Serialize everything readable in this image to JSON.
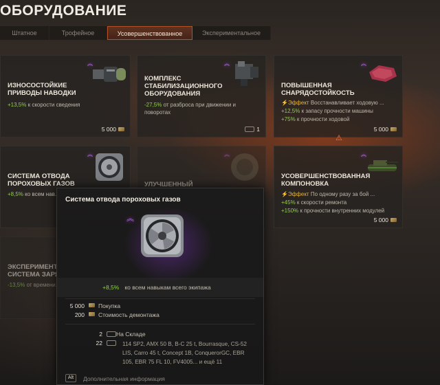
{
  "page": {
    "title": "ОБОРУДОВАНИЕ"
  },
  "tabs": [
    {
      "label": "Штатное"
    },
    {
      "label": "Трофейное"
    },
    {
      "label": "Усовершенствованное",
      "selected": true
    },
    {
      "label": "Экспериментальное"
    }
  ],
  "cards": [
    {
      "title": "ИЗНОСОСТОЙКИЕ ПРИВОДЫ НАВОДКИ",
      "bonus_value": "+13,5%",
      "bonus_text": "к скорости сведения",
      "price": "5 000"
    },
    {
      "title": "КОМПЛЕКС СТАБИЛИЗАЦИОННОГО ОБОРУДОВАНИЯ",
      "bonus_value": "-27,5%",
      "bonus_text": "от разброса при движении и поворотах",
      "count": "1"
    },
    {
      "title": "ПОВЫШЕННАЯ СНАРЯДОСТОЙКОСТЬ",
      "effect_label": "Эффект",
      "effect_text": "Восстанавливает ходовую ...",
      "bonus1_value": "+12,5%",
      "bonus1_text": "к запасу прочности машины",
      "bonus2_value": "+75%",
      "bonus2_text": "к прочности ходовой",
      "price": "5 000"
    },
    {
      "title": "СИСТЕМА ОТВОДА ПОРОХОВЫХ ГАЗОВ",
      "bonus_value": "+8,5%",
      "bonus_text": "ко всем нав..."
    },
    {
      "title": "УЛУЧШЕННЫЙ КОМПРЕССОР"
    },
    {
      "title": "УСОВЕРШЕНСТВОВАННАЯ КОМПОНОВКА",
      "effect_label": "Эффект",
      "effect_text": "По одному разу за бой ...",
      "bonus1_value": "+45%",
      "bonus1_text": "к скорости ремонта",
      "bonus2_value": "+150%",
      "bonus2_text": "к прочности внутренних модулей",
      "price": "5 000"
    },
    {
      "title": "ЭКСПЕРИМЕНТАЛ... СИСТЕМА ЗАРЯЖ...",
      "bonus_value": "-13,5%",
      "bonus_text": "от времени..."
    }
  ],
  "tooltip": {
    "title": "Система отвода пороховых газов",
    "bonus_value": "+8,5%",
    "bonus_text": "ко всем навыкам всего экипажа",
    "purchase_value": "5 000",
    "purchase_label": "Покупка",
    "demount_value": "200",
    "demount_label": "Стоимость демонтажа",
    "stock_value": "2",
    "stock_label": "На Складе",
    "tanks_value": "22",
    "tanks_list": "114 SP2, AMX 50 B, B-C 25 t, Bourrasque, CS-52 LIS, Carro 45 t, Concept 1B, ConquerorGC, EBR 105, EBR 75 FL 10, FV4005... и ещё 11",
    "alt_key": "Alt",
    "more_info": "Дополнительная информация"
  },
  "colors": {
    "accent": "#b4522a",
    "positive": "#8fcf4a",
    "effect": "#e7b33a",
    "rank": "#c86dff"
  },
  "icons": [
    "rank-chevron-icon",
    "credit-icon",
    "tank-icon",
    "warning-icon",
    "alt-key-icon"
  ]
}
